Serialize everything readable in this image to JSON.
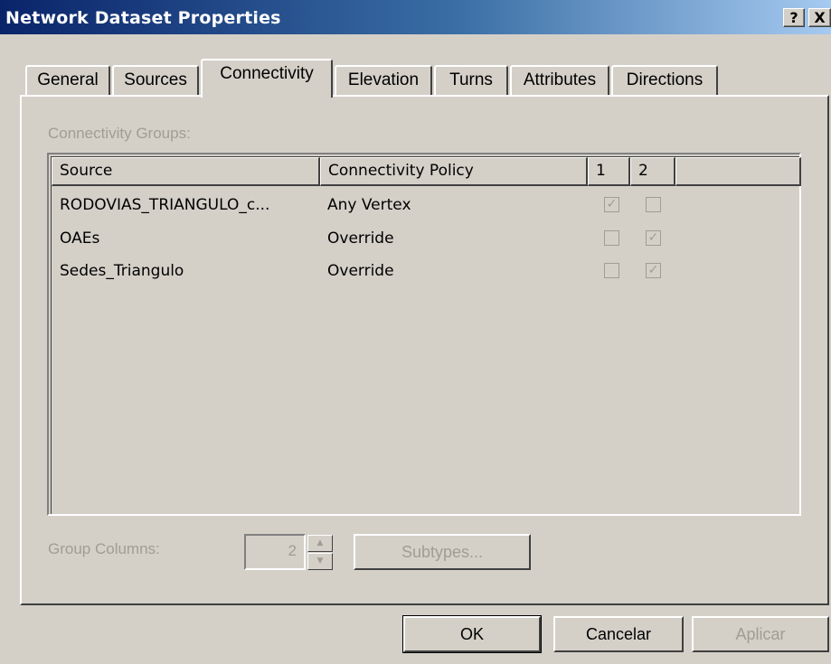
{
  "window": {
    "title": "Network Dataset Properties",
    "help_label": "?",
    "close_label": "X"
  },
  "tabs": [
    {
      "label": "General",
      "active": false
    },
    {
      "label": "Sources",
      "active": false
    },
    {
      "label": "Connectivity",
      "active": true
    },
    {
      "label": "Elevation",
      "active": false
    },
    {
      "label": "Turns",
      "active": false
    },
    {
      "label": "Attributes",
      "active": false
    },
    {
      "label": "Directions",
      "active": false
    }
  ],
  "connectivity": {
    "groups_label": "Connectivity Groups:",
    "columns": {
      "source": "Source",
      "policy": "Connectivity Policy",
      "group1": "1",
      "group2": "2"
    },
    "rows": [
      {
        "source": "RODOVIAS_TRIANGULO_c...",
        "policy": "Any Vertex",
        "group1": true,
        "group2": false
      },
      {
        "source": "OAEs",
        "policy": "Override",
        "group1": false,
        "group2": true
      },
      {
        "source": "Sedes_Triangulo",
        "policy": "Override",
        "group1": false,
        "group2": true
      }
    ],
    "group_columns_label": "Group Columns:",
    "group_columns_value": "2",
    "subtypes_label": "Subtypes..."
  },
  "buttons": {
    "ok": "OK",
    "cancel": "Cancelar",
    "apply": "Aplicar"
  },
  "glyphs": {
    "check": "✓",
    "spin_up": "▲",
    "spin_down": "▼"
  },
  "colors": {
    "face": "#d4d0c8",
    "disabled_text": "#a19d95",
    "title_start": "#0a246a",
    "title_end": "#a6caf0"
  }
}
